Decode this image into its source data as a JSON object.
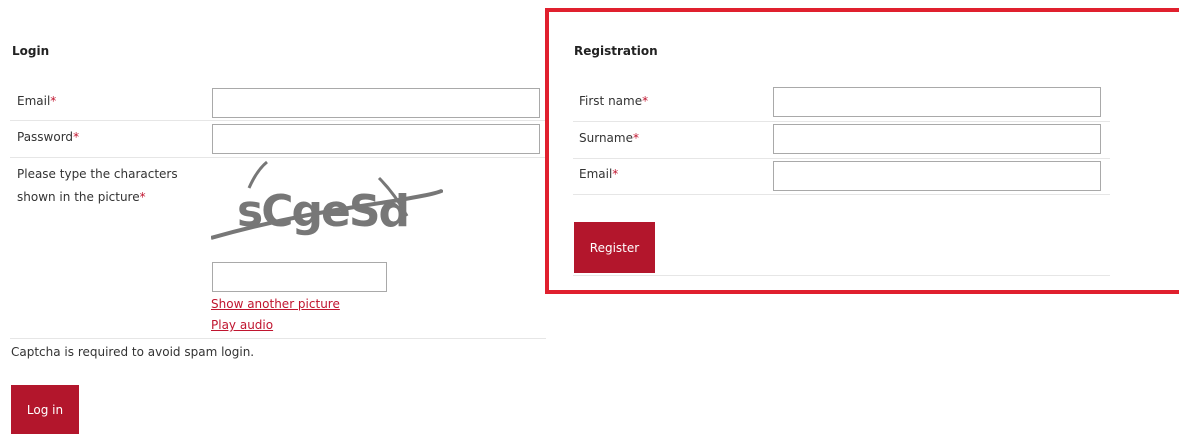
{
  "login": {
    "title": "Login",
    "email_label": "Email",
    "email_value": "",
    "password_label": "Password",
    "password_value": "",
    "captcha_label_line1": "Please type the characters",
    "captcha_label_line2": "shown in the picture",
    "captcha_value": "",
    "captcha_text": "sCgeSd",
    "show_another_link": "Show another picture",
    "play_audio_link": "Play audio",
    "captcha_note": "Captcha is required to avoid spam login.",
    "button_label": "Log in"
  },
  "registration": {
    "title": "Registration",
    "first_name_label": "First name",
    "first_name_value": "",
    "surname_label": "Surname",
    "surname_value": "",
    "email_label": "Email",
    "email_value": "",
    "button_label": "Register"
  },
  "required_marker": "*",
  "colors": {
    "accent": "#b3162c",
    "required": "#c0152f",
    "highlight": "#e0202e"
  }
}
